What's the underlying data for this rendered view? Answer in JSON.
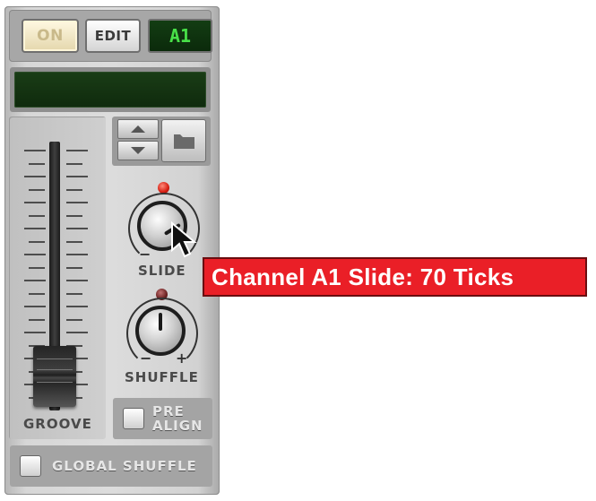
{
  "topbar": {
    "on_label": "ON",
    "edit_label": "EDIT",
    "channel_display": "A1"
  },
  "groove": {
    "fader_label": "GROOVE"
  },
  "slide": {
    "label": "SLIDE",
    "minus": "−",
    "value_ticks": 70
  },
  "shuffle": {
    "label": "SHUFFLE",
    "minus": "−",
    "plus": "+"
  },
  "pre_align": {
    "line1": "PRE",
    "line2": "ALIGN"
  },
  "global_shuffle": {
    "label": "GLOBAL SHUFFLE"
  },
  "tooltip": {
    "text": "Channel A1 Slide: 70 Ticks"
  },
  "icons": [
    "arrow-up-icon",
    "arrow-down-icon",
    "folder-icon",
    "mouse-pointer-icon"
  ],
  "colors": {
    "tooltip_bg": "#ea1f27",
    "lcd_text": "#48e048",
    "led_on": "#d41c10"
  }
}
